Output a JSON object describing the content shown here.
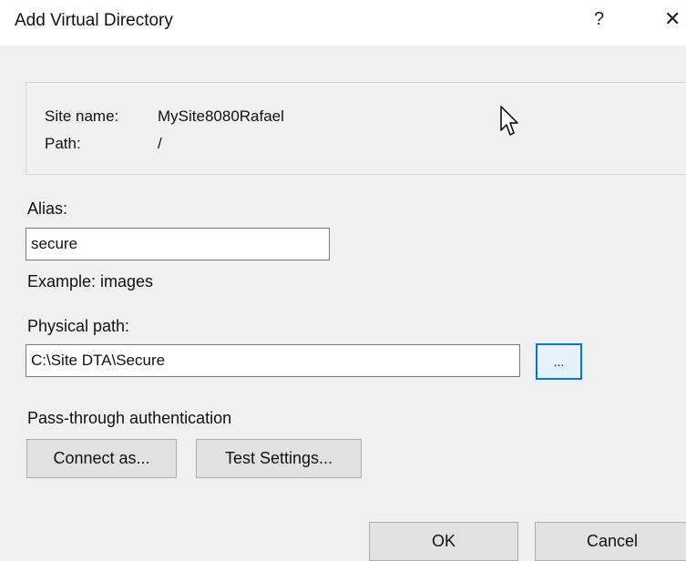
{
  "window": {
    "title": "Add Virtual Directory",
    "help_label": "?",
    "close_label": "✕"
  },
  "info": {
    "site_name_label": "Site name:",
    "site_name_value": "MySite8080Rafael",
    "path_label": "Path:",
    "path_value": "/"
  },
  "alias": {
    "label": "Alias:",
    "value": "secure",
    "example": "Example: images"
  },
  "physical_path": {
    "label": "Physical path:",
    "value": "C:\\Site DTA\\Secure",
    "browse_label": "..."
  },
  "auth": {
    "label": "Pass-through authentication",
    "connect_as_label": "Connect as...",
    "test_settings_label": "Test Settings..."
  },
  "footer": {
    "ok_label": "OK",
    "cancel_label": "Cancel"
  },
  "icons": {
    "cursor": "mouse-pointer-icon"
  }
}
